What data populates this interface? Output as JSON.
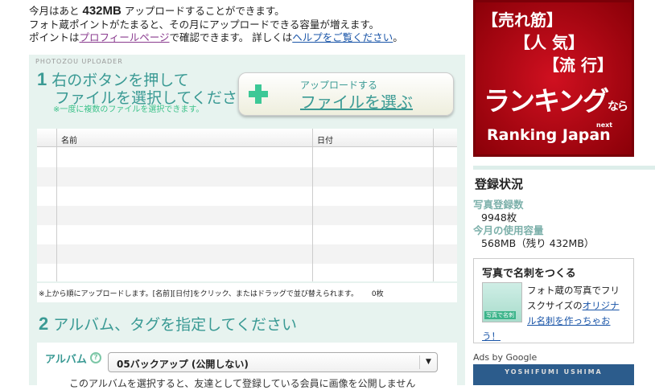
{
  "intro": {
    "line1_pre": "今月はあと",
    "quota": "432MB",
    "line1_post": "アップロードすることができます。",
    "line2": "フォト蔵ポイントがたまると、その月にアップロードできる容量が増えます。",
    "line3_pre": "ポイントは",
    "profile_link": "プロフィールページ",
    "line3_mid": "で確認できます。 詳しくは",
    "help_link": "ヘルプをご覧ください",
    "line3_post": "。"
  },
  "uploader": {
    "brand": "PHOTOZOU UPLOADER",
    "step1_num": "1",
    "step1_line1": "右のボタンを押して",
    "step1_line2": "ファイルを選択してください",
    "step1_note": "※一度に複数のファイルを選択できます。",
    "upload_button_top": "アップロードする",
    "upload_button_main": "ファイルを選ぶ",
    "table": {
      "col_name": "名前",
      "col_date": "日付",
      "rows": 7
    },
    "table_note": "※上から順にアップロードします。[名前][日付]をクリック、またはドラッグで並び替えられます。",
    "file_count": "0枚",
    "step2_num": "2",
    "step2_title": "アルバム、タグを指定してください",
    "album_label": "アルバム",
    "album_help": "?",
    "album_value": "05バックアップ (公開しない)",
    "album_desc": "このアルバムを選択すると、友達として登録している会員に画像を公開しません"
  },
  "ad_banner": {
    "line1": "【売れ筋】",
    "line2": "【人 気】",
    "line3": "【流 行】",
    "line4": "ランキング",
    "line4_small": "なら",
    "line5": "Ranking Japan",
    "line5_small": "next"
  },
  "sidebar": {
    "status_title": "登録状況",
    "photos_label": "写真登録数",
    "photos_value": "9948枚",
    "usage_label": "今月の使用容量",
    "usage_value": "568MB（残り 432MB）",
    "card": {
      "title": "写真で名刺をつくる",
      "thumb_label": "写真で名刺",
      "text": "フォト蔵の写真でフリスクサイズの",
      "link": "オリジナル名刺を作っちゃおう！"
    },
    "ads_label": "Ads by Google",
    "ad_image_text": "YOSHIFUMI USHIMA"
  },
  "colors": {
    "accent": "#3a9a94",
    "panel_bg": "#e7f3ef",
    "plus": "#3cc896",
    "banner_red": "#c01020"
  }
}
